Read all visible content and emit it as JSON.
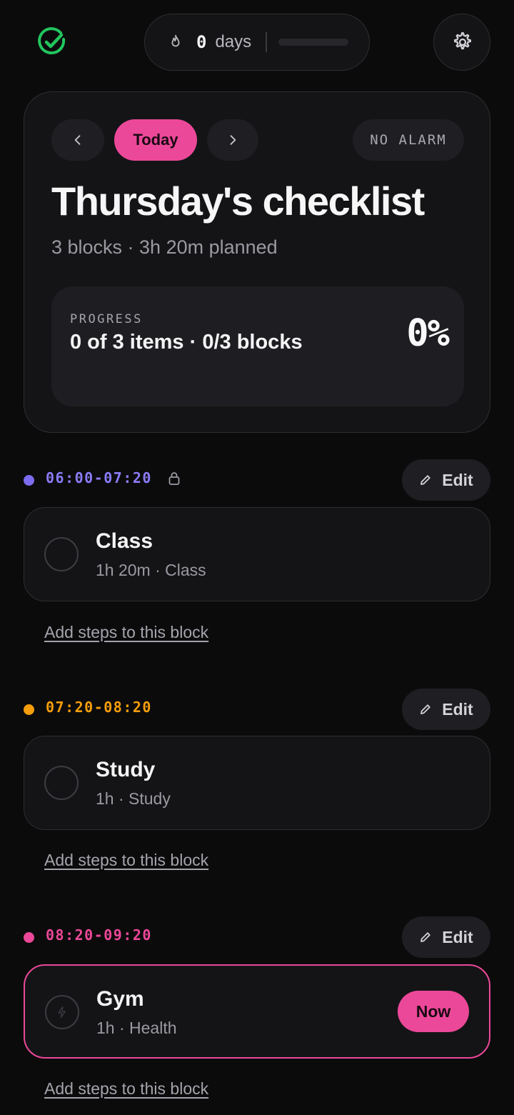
{
  "header": {
    "streak_value": "0",
    "streak_unit": "days"
  },
  "day": {
    "prev_icon": "chevron-left-icon",
    "today_label": "Today",
    "next_icon": "chevron-right-icon",
    "alarm_label": "NO ALARM",
    "title": "Thursday's checklist",
    "subtitle": "3 blocks · 3h 20m planned",
    "progress_label": "PROGRESS",
    "progress_detail": "0 of 3 items · 0/3 blocks",
    "progress_percent": "0%"
  },
  "blocks": [
    {
      "time": "06:00-07:20",
      "dot_color": "#7c6cf0",
      "time_color": "#8b7cf6",
      "locked": true,
      "edit_label": "Edit",
      "name": "Class",
      "meta": "1h 20m · Class",
      "add_steps_label": "Add steps to this block"
    },
    {
      "time": "07:20-08:20",
      "dot_color": "#f59e0b",
      "time_color": "#f59e0b",
      "locked": false,
      "edit_label": "Edit",
      "name": "Study",
      "meta": "1h · Study",
      "add_steps_label": "Add steps to this block"
    },
    {
      "time": "08:20-09:20",
      "dot_color": "#ec4899",
      "time_color": "#ec4899",
      "locked": false,
      "edit_label": "Edit",
      "name": "Gym",
      "meta": "1h · Health",
      "now_label": "Now",
      "active": true,
      "add_steps_label": "Add steps to this block"
    }
  ],
  "colors": {
    "accent": "#ec4899",
    "logo": "#22c55e",
    "background": "#0b0b0c",
    "card": "#141416"
  }
}
